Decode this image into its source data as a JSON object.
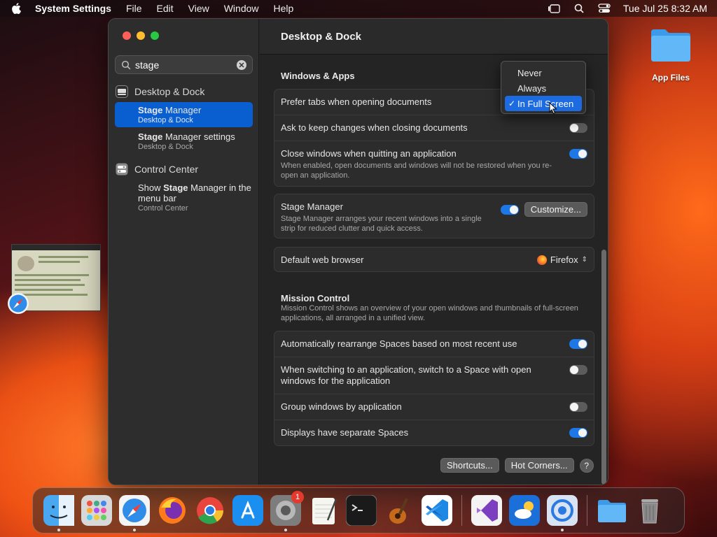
{
  "menubar": {
    "app_name": "System Settings",
    "items": [
      "File",
      "Edit",
      "View",
      "Window",
      "Help"
    ],
    "datetime": "Tue Jul 25  8:32 AM"
  },
  "desktop": {
    "folder_label": "App Files"
  },
  "window": {
    "title": "Desktop & Dock",
    "search": {
      "value": "stage",
      "placeholder": "Search"
    },
    "sidebar": {
      "cat1": "Desktop & Dock",
      "result1": {
        "bold": "Stage",
        "rest": " Manager",
        "sub": "Desktop & Dock"
      },
      "result2": {
        "bold": "Stage",
        "rest": " Manager settings",
        "sub": "Desktop & Dock"
      },
      "cat2": "Control Center",
      "result3": {
        "pre": "Show ",
        "bold": "Stage",
        "rest": " Manager in the menu bar",
        "sub": "Control Center"
      }
    },
    "windows_apps": {
      "heading": "Windows & Apps",
      "prefer_tabs": "Prefer tabs when opening documents",
      "ask_keep": "Ask to keep changes when closing documents",
      "close_windows": "Close windows when quitting an application",
      "close_windows_desc": "When enabled, open documents and windows will not be restored when you re-open an application.",
      "stage_manager": "Stage Manager",
      "stage_manager_desc": "Stage Manager arranges your recent windows into a single strip for reduced clutter and quick access.",
      "customize": "Customize...",
      "default_browser": "Default web browser",
      "browser_value": "Firefox"
    },
    "mission_control": {
      "heading": "Mission Control",
      "desc": "Mission Control shows an overview of your open windows and thumbnails of full-screen applications, all arranged in a unified view.",
      "auto_rearrange": "Automatically rearrange Spaces based on most recent use",
      "switch_space": "When switching to an application, switch to a Space with open windows for the application",
      "group_windows": "Group windows by application",
      "separate_spaces": "Displays have separate Spaces"
    },
    "buttons": {
      "shortcuts": "Shortcuts...",
      "hot_corners": "Hot Corners...",
      "help": "?"
    },
    "dropdown": {
      "options": [
        "Never",
        "Always",
        "In Full Screen"
      ],
      "selected": "In Full Screen",
      "check": "✓"
    }
  },
  "dock": {
    "settings_badge": "1"
  },
  "colors": {
    "accent": "#1d77e6",
    "selection": "#0a5fd0"
  }
}
